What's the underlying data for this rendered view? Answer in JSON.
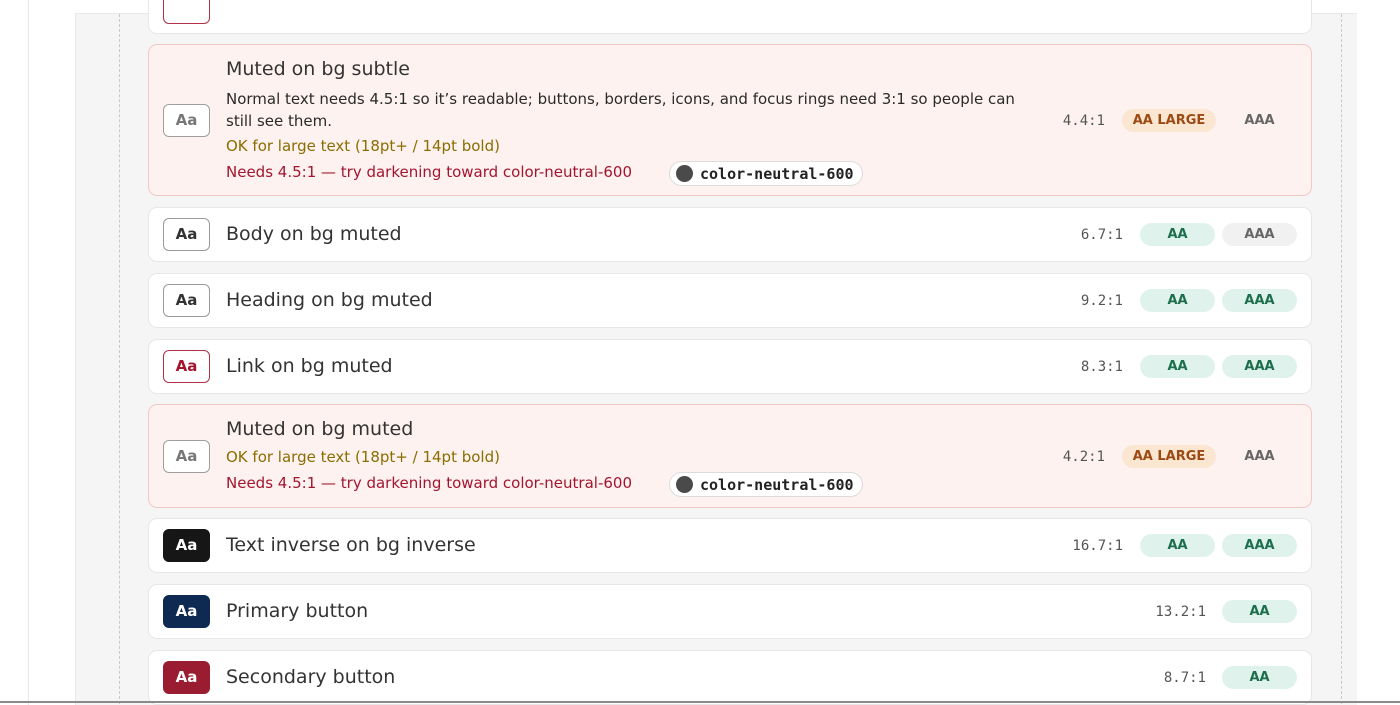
{
  "rows": [
    {
      "title": "Muted on bg subtle",
      "description": "Normal text needs 4.5:1 so it’s readable; buttons, borders, icons, and focus rings need 3:1 so people can still see them.",
      "ok_text": "OK for large text (18pt+ / 14pt bold)",
      "needs_text": "Needs 4.5:1 — try darkening toward color-neutral-600",
      "token": "color-neutral-600",
      "swatch": "Aa",
      "ratio": "4.4:1",
      "badge1": "AA LARGE",
      "badge2": "AAA"
    },
    {
      "title": "Body on bg muted",
      "swatch": "Aa",
      "ratio": "6.7:1",
      "badge1": "AA",
      "badge2": "AAA"
    },
    {
      "title": "Heading on bg muted",
      "swatch": "Aa",
      "ratio": "9.2:1",
      "badge1": "AA",
      "badge2": "AAA"
    },
    {
      "title": "Link on bg muted",
      "swatch": "Aa",
      "ratio": "8.3:1",
      "badge1": "AA",
      "badge2": "AAA"
    },
    {
      "title": "Muted on bg muted",
      "ok_text": "OK for large text (18pt+ / 14pt bold)",
      "needs_text": "Needs 4.5:1 — try darkening toward color-neutral-600",
      "token": "color-neutral-600",
      "swatch": "Aa",
      "ratio": "4.2:1",
      "badge1": "AA LARGE",
      "badge2": "AAA"
    },
    {
      "title": "Text inverse on bg inverse",
      "swatch": "Aa",
      "ratio": "16.7:1",
      "badge1": "AA",
      "badge2": "AAA"
    },
    {
      "title": "Primary button",
      "swatch": "Aa",
      "ratio": "13.2:1",
      "badge1": "AA"
    },
    {
      "title": "Secondary button",
      "swatch": "Aa",
      "ratio": "8.7:1",
      "badge1": "AA"
    }
  ],
  "colors": {
    "pass_bg": "#dff3ec",
    "pass_text": "#1c6e4d",
    "large_bg": "#fbe6d2",
    "large_text": "#9a4a12",
    "warn_bg": "#fdf2f0",
    "link": "#a3152f",
    "ok_text": "#8a6d00",
    "inverse": "#161616",
    "primary": "#0f2a52",
    "secondary": "#9a1c30"
  },
  "icons": {
    "token_dot": "color-dot-icon"
  }
}
